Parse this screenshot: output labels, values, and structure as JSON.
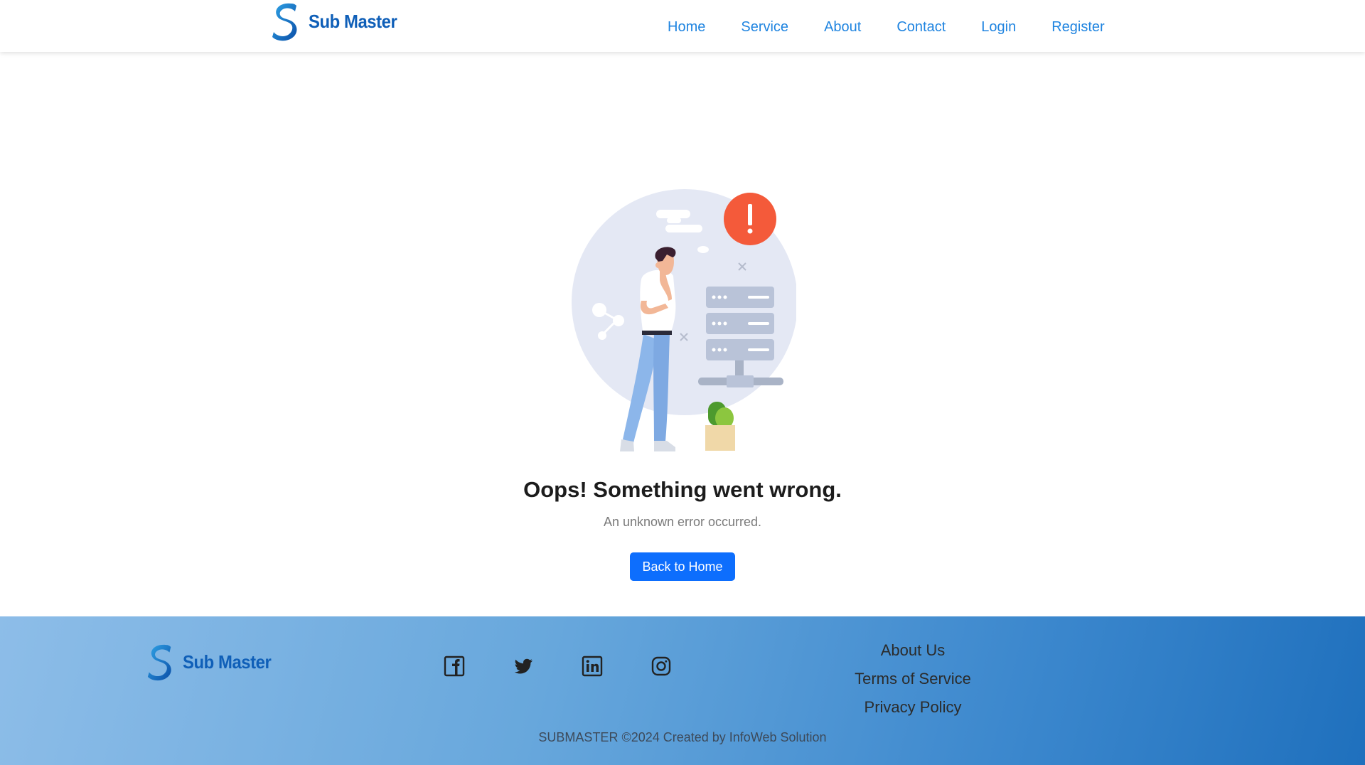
{
  "header": {
    "brand": "Sub Master",
    "nav": [
      "Home",
      "Service",
      "About",
      "Contact",
      "Login",
      "Register"
    ]
  },
  "error": {
    "title": "Oops! Something went wrong.",
    "message": "An unknown error occurred.",
    "button": "Back to Home"
  },
  "footer": {
    "brand": "Sub Master",
    "socials": [
      "facebook-icon",
      "twitter-icon",
      "linkedin-icon",
      "instagram-icon"
    ],
    "links": [
      "About Us",
      "Terms of Service",
      "Privacy Policy"
    ],
    "copyright": "SUBMASTER ©2024 Created by InfoWeb Solution"
  },
  "colors": {
    "brand": "#0f5fb8",
    "nav_link": "#1f84e0",
    "button": "#0d6efd",
    "alert": "#f45a3a"
  }
}
